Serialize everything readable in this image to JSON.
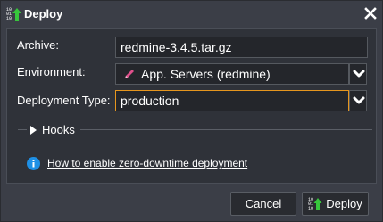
{
  "dialog": {
    "title": "Deploy",
    "close_icon": "close-icon",
    "title_icon": "deploy-icon"
  },
  "form": {
    "archive_label": "Archive:",
    "archive_value": "redmine-3.4.5.tar.gz",
    "environment_label": "Environment:",
    "environment_value": "App. Servers (redmine)",
    "environment_icon": "pen-icon",
    "deployment_type_label": "Deployment Type:",
    "deployment_type_value": "production"
  },
  "hooks": {
    "label": "Hooks"
  },
  "info": {
    "link_text": "How to enable zero-downtime deployment",
    "icon": "info-icon"
  },
  "buttons": {
    "cancel": "Cancel",
    "deploy": "Deploy"
  },
  "colors": {
    "accent_orange": "#e6961e",
    "info_blue": "#1e90e6",
    "deploy_green": "#37c63c",
    "pen_pink": "#e0508c"
  }
}
